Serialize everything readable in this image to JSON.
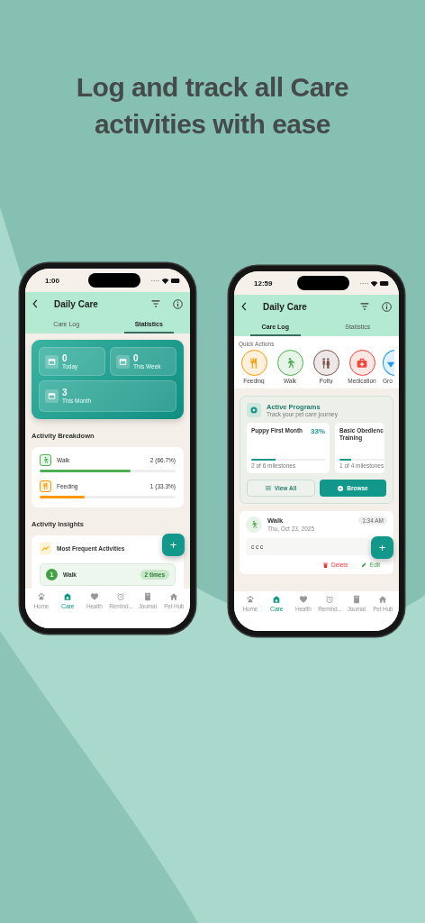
{
  "headline": "Log and track all Care activities with ease",
  "phones": [
    {
      "kind": "statistics",
      "time": "1:00",
      "title": "Daily Care",
      "tabs": [
        {
          "label": "Care Log",
          "selected": false
        },
        {
          "label": "Statistics",
          "selected": true
        }
      ],
      "stats": [
        {
          "value": "0",
          "label": "Today"
        },
        {
          "value": "0",
          "label": "This Week"
        },
        {
          "value": "3",
          "label": "This Month"
        }
      ],
      "breakdown_title": "Activity Breakdown",
      "breakdown": [
        {
          "kind": "walk",
          "name": "Walk",
          "reading": "2 (66.7%)",
          "level": 0.667,
          "color": "#4caf50"
        },
        {
          "kind": "feeding",
          "name": "Feeding",
          "reading": "1 (33.3%)",
          "level": 0.333,
          "color": "#ff9800"
        }
      ],
      "insights_title": "Activity Insights",
      "insight_card_title": "Most Frequent Activities",
      "frequent": [
        {
          "rank": "1",
          "name": "Walk",
          "count": "2 times"
        }
      ],
      "fab": "+",
      "nav": [
        {
          "kind": "paw",
          "label": "Home",
          "selected": false
        },
        {
          "kind": "care",
          "label": "Care",
          "selected": true
        },
        {
          "kind": "heart",
          "label": "Health",
          "selected": false
        },
        {
          "kind": "alarm",
          "label": "Remind...",
          "selected": false
        },
        {
          "kind": "book",
          "label": "Journal",
          "selected": false
        },
        {
          "kind": "house",
          "label": "Pet Hub",
          "selected": false
        }
      ]
    },
    {
      "kind": "care_log",
      "time": "12:59",
      "title": "Daily Care",
      "tabs": [
        {
          "label": "Care Log",
          "selected": true
        },
        {
          "label": "Statistics",
          "selected": false
        }
      ],
      "quick_title": "Quick Actions",
      "quick_actions": [
        {
          "kind": "feeding",
          "label": "Feeding",
          "color": "#ff9800"
        },
        {
          "kind": "walk",
          "label": "Walk",
          "color": "#4caf50"
        },
        {
          "kind": "potty",
          "label": "Potty",
          "color": "#795548"
        },
        {
          "kind": "medication",
          "label": "Medication",
          "color": "#f44336"
        },
        {
          "kind": "group",
          "label": "Gro",
          "color": "#2196f3"
        }
      ],
      "programs_title": "Active Programs",
      "programs_subtitle": "Track your pet care journey",
      "programs": [
        {
          "title": "Puppy First Month",
          "percent": "33%",
          "level": 0.33,
          "milestones": "2 of 6 milestones"
        },
        {
          "title": "Basic Obedienc Training",
          "level": 0.25,
          "milestones": "1 of 4 milestones"
        }
      ],
      "view_all": "View All",
      "browse": "Browse",
      "entry": {
        "kind": "walk",
        "title": "Walk",
        "date": "Thu, Oct 23, 2025",
        "time": "1:34 AM",
        "note": "c c c",
        "delete": "Delete",
        "edit": "Edit"
      },
      "fab": "+",
      "nav": [
        {
          "kind": "paw",
          "label": "Home",
          "selected": false
        },
        {
          "kind": "care",
          "label": "Care",
          "selected": true
        },
        {
          "kind": "heart",
          "label": "Health",
          "selected": false
        },
        {
          "kind": "alarm",
          "label": "Remind...",
          "selected": false
        },
        {
          "kind": "book",
          "label": "Journal",
          "selected": false
        },
        {
          "kind": "house",
          "label": "Pet Hub",
          "selected": false
        }
      ]
    }
  ]
}
